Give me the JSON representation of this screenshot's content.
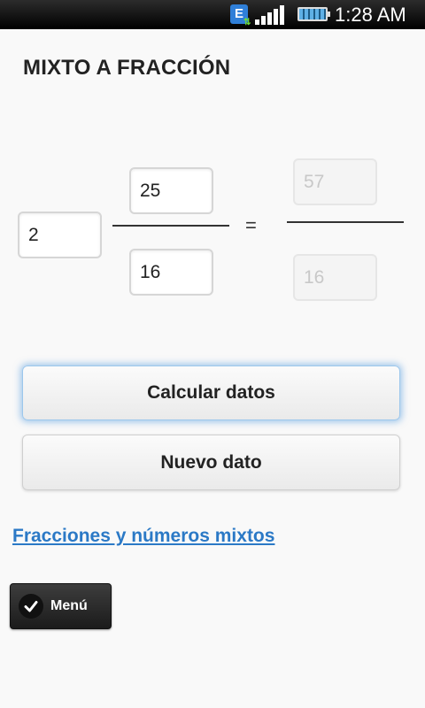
{
  "status_bar": {
    "network_badge": "E",
    "time": "1:28 AM",
    "icons": [
      "e-data-icon",
      "signal-icon",
      "battery-icon"
    ]
  },
  "page": {
    "title": "MIXTO A FRACCIÓN"
  },
  "inputs": {
    "whole": "2",
    "numerator": "25",
    "denominator": "16"
  },
  "operator": "=",
  "result": {
    "numerator": "57",
    "denominator": "16"
  },
  "buttons": {
    "calculate": "Calcular datos",
    "new": "Nuevo dato"
  },
  "link": "Fracciones y números mixtos",
  "menu": {
    "label": "Menú",
    "icon": "check-icon"
  },
  "colors": {
    "link": "#2b79c6",
    "focus_glow": "#549bde",
    "status_bar": "#000000"
  }
}
